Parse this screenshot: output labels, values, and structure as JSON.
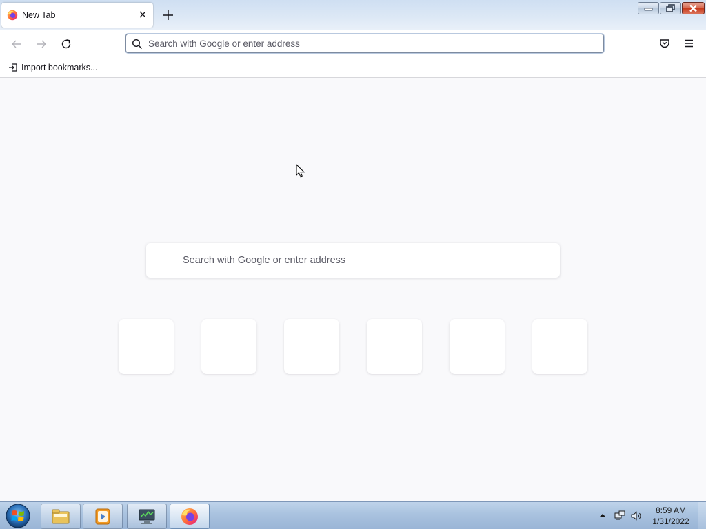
{
  "browser": {
    "tab": {
      "title": "New Tab",
      "favicon": "firefox-icon"
    },
    "urlbar": {
      "placeholder": "Search with Google or enter address",
      "value": ""
    },
    "bookmarks": {
      "import_label": "Import bookmarks..."
    }
  },
  "newtab": {
    "search_placeholder": "Search with Google or enter address",
    "top_site_count": 6
  },
  "taskbar": {
    "apps": [
      "explorer-icon",
      "media-player-icon",
      "network-monitor-icon",
      "firefox-icon"
    ],
    "active_app": "firefox-icon",
    "clock": {
      "time": "8:59 AM",
      "date": "1/31/2022"
    }
  },
  "colors": {
    "accent": "#0060df",
    "page_bg": "#f9f9fb",
    "text": "#15141a"
  }
}
